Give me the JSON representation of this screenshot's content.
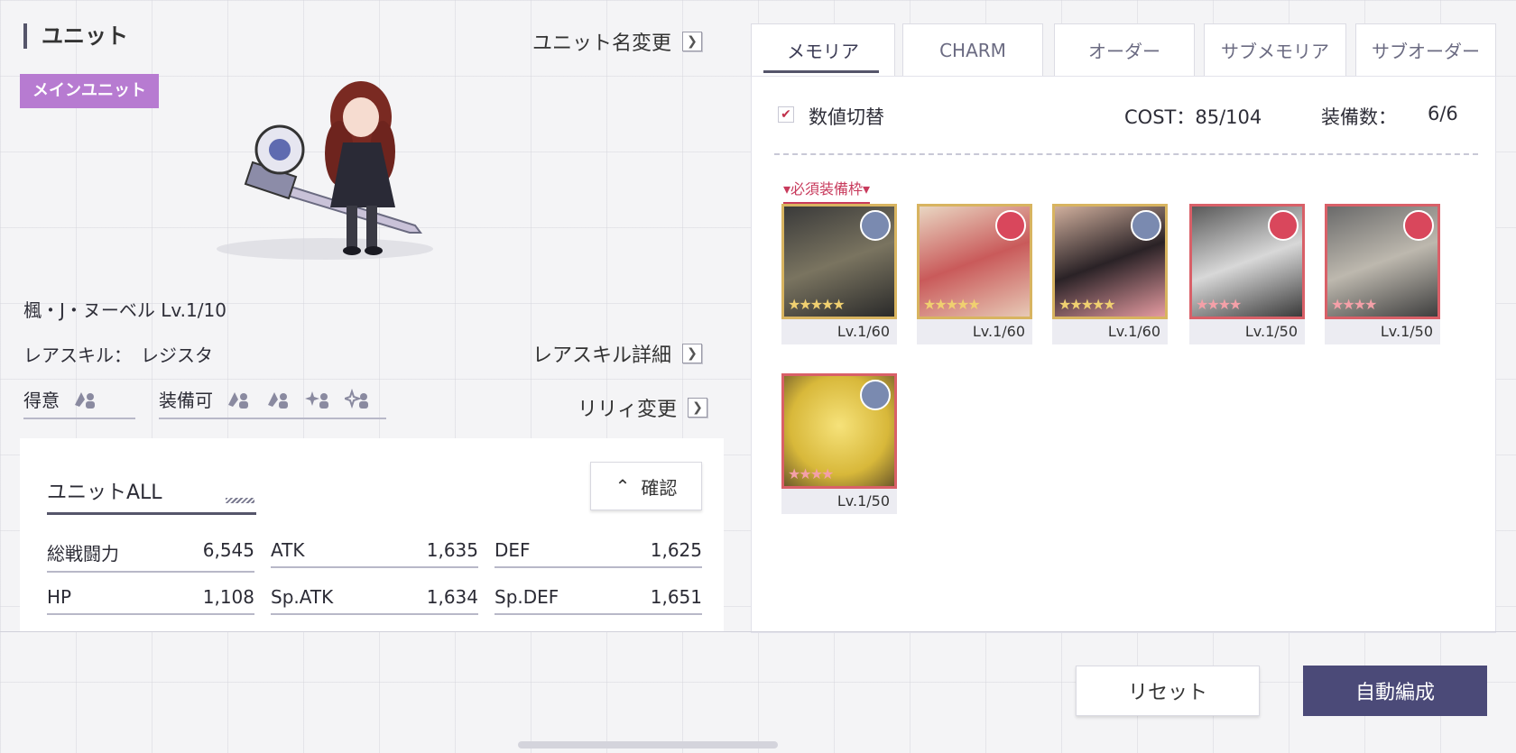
{
  "header": {
    "title": "ユニット",
    "rename_label": "ユニット名変更",
    "main_badge": "メインユニット"
  },
  "unit": {
    "name_level": "楓・J・ヌーベル  Lv.1/10",
    "rare_skill_label": "レアスキル：",
    "rare_skill_value": "レジスタ",
    "rare_skill_detail": "レアスキル詳細",
    "specialty_label": "得意",
    "equippable_label": "装備可",
    "lily_change": "リリィ変更"
  },
  "stats": {
    "title": "ユニットALL",
    "confirm_label": "確認",
    "items": [
      {
        "label": "総戦闘力",
        "value": "6,545"
      },
      {
        "label": "ATK",
        "value": "1,635"
      },
      {
        "label": "DEF",
        "value": "1,625"
      },
      {
        "label": "HP",
        "value": "1,108"
      },
      {
        "label": "Sp.ATK",
        "value": "1,634"
      },
      {
        "label": "Sp.DEF",
        "value": "1,651"
      }
    ]
  },
  "tabs": [
    {
      "label": "メモリア",
      "active": true
    },
    {
      "label": "CHARM",
      "active": false
    },
    {
      "label": "オーダー",
      "active": false
    },
    {
      "label": "サブメモリア",
      "active": false
    },
    {
      "label": "サブオーダー",
      "active": false
    }
  ],
  "memoria": {
    "toggle_label": "数値切替",
    "cost_label": "COST：85/104",
    "equip_label": "装備数：",
    "equip_value": "6/6",
    "required_label": "必須装備枠",
    "cards": [
      {
        "level": "Lv.1/60",
        "stars": "★★★★★",
        "frame": "gold",
        "role": "blue"
      },
      {
        "level": "Lv.1/60",
        "stars": "★★★★★",
        "frame": "gold",
        "role": "red"
      },
      {
        "level": "Lv.1/60",
        "stars": "★★★★★",
        "frame": "gold",
        "role": "blue"
      },
      {
        "level": "Lv.1/50",
        "stars": "★★★★",
        "frame": "red",
        "role": "red"
      },
      {
        "level": "Lv.1/50",
        "stars": "★★★★",
        "frame": "red",
        "role": "red"
      },
      {
        "level": "Lv.1/50",
        "stars": "★★★★",
        "frame": "red",
        "role": "blue"
      }
    ]
  },
  "footer": {
    "reset_label": "リセット",
    "auto_label": "自動編成"
  },
  "colors": {
    "accent": "#4b4a78",
    "badge": "#b77bd1",
    "required": "#c83a5c",
    "gold_frame": "#d8b460",
    "red_frame": "#d96068"
  }
}
